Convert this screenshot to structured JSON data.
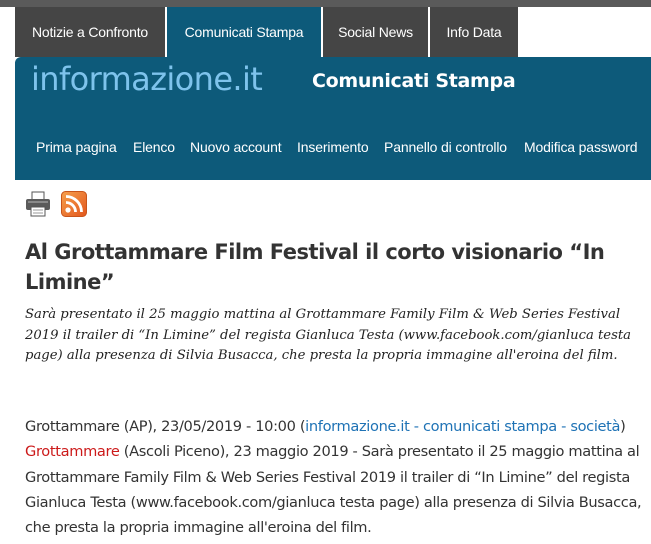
{
  "top_tabs": [
    {
      "label": "Notizie a Confronto"
    },
    {
      "label": "Comunicati Stampa",
      "active": true
    },
    {
      "label": "Social News"
    },
    {
      "label": "Info Data"
    }
  ],
  "header": {
    "logo": "informazione.it",
    "section_title": "Comunicati Stampa"
  },
  "nav": [
    {
      "label": "Prima pagina"
    },
    {
      "label": "Elenco"
    },
    {
      "label": "Nuovo account"
    },
    {
      "label": "Inserimento"
    },
    {
      "label": "Pannello di controllo"
    },
    {
      "label": "Modifica password"
    }
  ],
  "tools": {
    "print_icon": "printer-icon",
    "rss_icon": "rss-icon"
  },
  "article": {
    "title": "Al Grottammare Film Festival il corto visionario “In Limine”",
    "summary": "Sarà presentato il 25 maggio mattina al Grottammare Family Film & Web Series Festival 2019 il trailer di “In Limine” del regista Gianluca Testa (www.facebook.com/gianluca testa page) alla presenza di Silvia Busacca, che presta la propria immagine all'eroina del film.",
    "dateline": "Grottammare (AP), 23/05/2019 - 10:00 (",
    "source_link": "informazione.it - comunicati stampa - società",
    "dateline_close": ") ",
    "tag_link": "Grottammare",
    "body": " (Ascoli Piceno), 23 maggio 2019 - Sarà presentato il 25 maggio mattina al Grottammare Family Film & Web Series Festival 2019 il trailer di “In Limine” del regista Gianluca Testa (www.facebook.com/gianluca testa page) alla presenza di Silvia Busacca, che presta la propria immagine all'eroina del film."
  },
  "colors": {
    "header_bg": "#0d5a7a",
    "tab_bg": "#454545",
    "logo": "#7ec3ec",
    "link": "#1e72b5",
    "tag": "#cc1a1a"
  }
}
